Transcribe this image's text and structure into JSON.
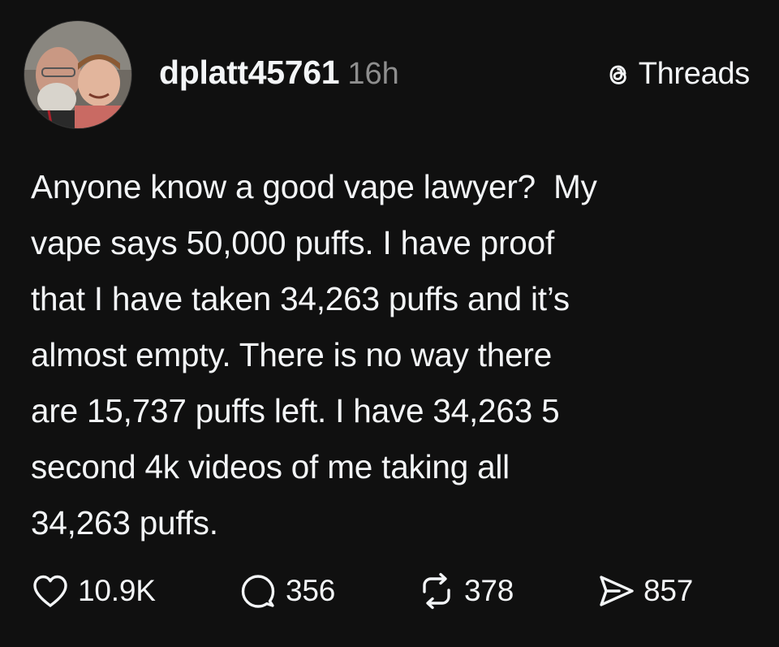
{
  "post": {
    "username": "dplatt45761",
    "timestamp": "16h",
    "brand": {
      "label": "Threads",
      "icon": "threads-logo-icon"
    },
    "text": "Anyone know a good vape lawyer?  My\nvape says 50,000 puffs. I have proof\nthat I have taken 34,263 puffs and it’s\nalmost empty. There is no way there\nare 15,737 puffs left. I have 34,263 5\nsecond 4k videos of me taking all\n34,263 puffs.",
    "actions": {
      "likes": {
        "icon": "heart-icon",
        "count": "10.9K"
      },
      "replies": {
        "icon": "comment-icon",
        "count": "356"
      },
      "reposts": {
        "icon": "repost-icon",
        "count": "378"
      },
      "shares": {
        "icon": "send-icon",
        "count": "857"
      }
    }
  },
  "colors": {
    "background": "#101010",
    "text_primary": "#f3f5f7",
    "text_secondary": "#8e8e8e"
  }
}
